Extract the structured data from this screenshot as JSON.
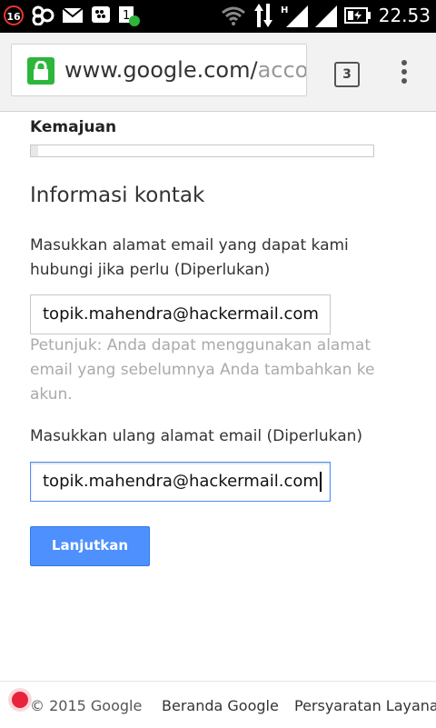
{
  "status_bar": {
    "notification_badge": "16",
    "time": "22.53",
    "icons": [
      "notification-badge-icon",
      "sync-icon",
      "mail-icon",
      "bbm-icon",
      "sync-update-icon",
      "wifi-icon",
      "data-transfer-icon",
      "hspa-icon",
      "signal-icon",
      "battery-icon"
    ]
  },
  "browser": {
    "url_main": "www.google.com/",
    "url_rest": "accou",
    "tab_count": "3"
  },
  "page": {
    "progress_label": "Kemajuan",
    "progress_value": 0.02,
    "section_title": "Informasi kontak",
    "email_label": "Masukkan alamat email yang dapat kami hubungi jika perlu (Diperlukan)",
    "email_value": "topik.mahendra@hackermail.com",
    "hint": "Petunjuk: Anda dapat menggunakan alamat email yang sebelumnya Anda tambahkan ke akun.",
    "confirm_label": "Masukkan ulang alamat email (Diperlukan)",
    "confirm_value": "topik.mahendra@hackermail.com",
    "continue_button": "Lanjutkan"
  },
  "footer": {
    "copyright": "© 2015 Google",
    "link_home": "Beranda Google",
    "link_terms": "Persyaratan Layanan"
  },
  "colors": {
    "button_blue": "#4d90fe",
    "lock_green": "#2db63b",
    "record_red": "#e8233b"
  }
}
